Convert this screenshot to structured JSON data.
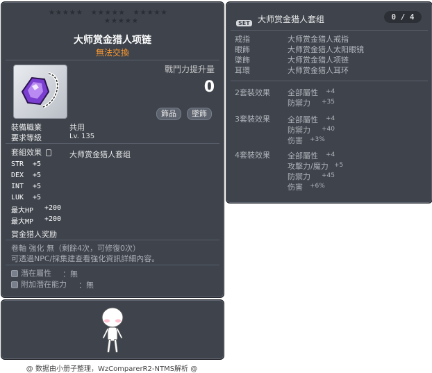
{
  "item_id": "01122288",
  "name": "大师赏金猎人项链",
  "trade_status": "無法交換",
  "power_label": "戰鬥力提升量",
  "power_value": "0",
  "tags": [
    "飾品",
    "墜飾"
  ],
  "requirements": {
    "job_label": "裝備職業",
    "job_value": "共用",
    "level_label": "要求等級",
    "level_value": "Lv. 135"
  },
  "set_effect_label": "套組效果",
  "set_effect_name": "大师赏金猎人套组",
  "stats": [
    {
      "k": "STR",
      "v": "+5"
    },
    {
      "k": "DEX",
      "v": "+5"
    },
    {
      "k": "INT",
      "v": "+5"
    },
    {
      "k": "LUK",
      "v": "+5"
    },
    {
      "k": "最大HP",
      "v": "+200"
    },
    {
      "k": "最大MP",
      "v": "+200"
    }
  ],
  "reward": "賞金猎人奖励",
  "scroll_line": "卷軸 強化 無（剩餘4次，可修復0次）",
  "npc_line": "可透過NPC/採集建查看強化資訊詳細內容。",
  "potential": {
    "label": "潛在屬性",
    "value": "：無"
  },
  "bonus_potential": {
    "label": "附加潛在能力",
    "value": "：無"
  },
  "footer": "@ 数据由小册子整理，WzComparerR2-NTMS解析 @",
  "set": {
    "badge": "SET",
    "title": "大师赏金猎人套组",
    "count": "0 / 4",
    "parts": [
      {
        "slot": "戒指",
        "name": "大师赏金猎人戒指"
      },
      {
        "slot": "眼飾",
        "name": "大师赏金猎人太阳眼镜"
      },
      {
        "slot": "墜飾",
        "name": "大师赏金猎人项链"
      },
      {
        "slot": "耳環",
        "name": "大师赏金猎人耳环"
      }
    ],
    "effects": [
      {
        "label": "2套裝效果",
        "lines": [
          {
            "k": "全部屬性",
            "v": "+4"
          },
          {
            "k": "防禦力",
            "v": "+35"
          }
        ]
      },
      {
        "label": "3套裝效果",
        "lines": [
          {
            "k": "全部屬性",
            "v": "+4"
          },
          {
            "k": "防禦力",
            "v": "+40"
          },
          {
            "k": "伤害",
            "v": "+3%"
          }
        ]
      },
      {
        "label": "4套裝效果",
        "lines": [
          {
            "k": "全部屬性",
            "v": "+4"
          },
          {
            "k": "攻擊力/魔力",
            "v": "+5"
          },
          {
            "k": "防禦力",
            "v": "+45"
          },
          {
            "k": "伤害",
            "v": "+6%"
          }
        ]
      }
    ]
  }
}
